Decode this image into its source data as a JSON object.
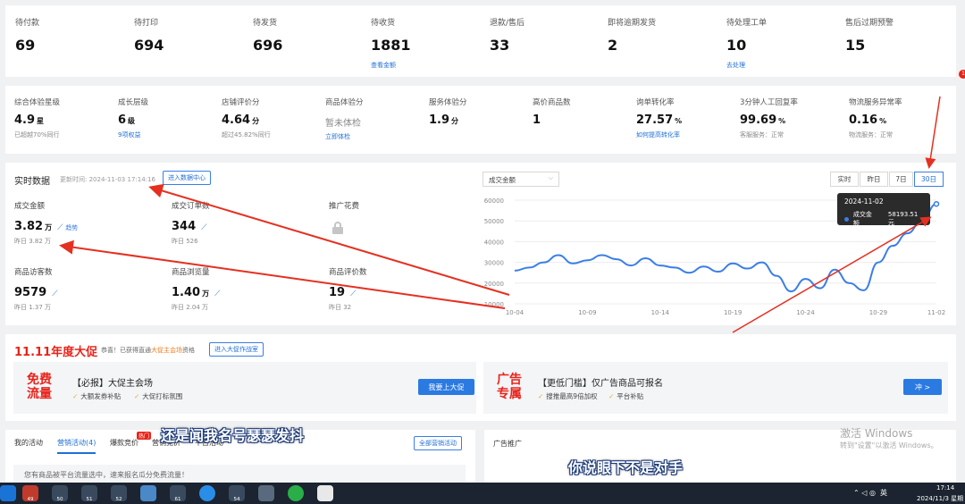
{
  "top_stats": [
    {
      "label": "待付款",
      "value": "69",
      "link": ""
    },
    {
      "label": "待打印",
      "value": "694",
      "link": ""
    },
    {
      "label": "待发货",
      "value": "696",
      "link": ""
    },
    {
      "label": "待收货",
      "value": "1881",
      "link": "查看金额"
    },
    {
      "label": "退款/售后",
      "value": "33",
      "link": ""
    },
    {
      "label": "即将逾期发货",
      "value": "2",
      "link": ""
    },
    {
      "label": "待处理工单",
      "value": "10",
      "link": "去处理"
    },
    {
      "label": "售后过期预警",
      "value": "15",
      "link": ""
    }
  ],
  "metrics": [
    {
      "label": "综合体验星级",
      "value": "4.9",
      "unit": "星",
      "sub": "已超越70%同行",
      "sub_link": false
    },
    {
      "label": "成长层级",
      "value": "6",
      "unit": "级",
      "sub": "9项权益",
      "sub_link": true
    },
    {
      "label": "店铺评价分",
      "value": "4.64",
      "unit": "分",
      "sub": "超过45.82%同行",
      "sub_link": false
    },
    {
      "label": "商品体验分",
      "value": "暂未体检",
      "unit": "",
      "sub": "立即体检",
      "sub_link": true
    },
    {
      "label": "服务体验分",
      "value": "1.9",
      "unit": "分",
      "sub": "",
      "sub_link": false
    },
    {
      "label": "高价商品数",
      "value": "1",
      "unit": "",
      "sub": "",
      "sub_link": false
    },
    {
      "label": "询单转化率",
      "value": "27.57",
      "unit": "%",
      "sub": "如何提高转化率",
      "sub_link": true
    },
    {
      "label": "3分钟人工回复率",
      "value": "99.69",
      "unit": "%",
      "sub": "客服服务：正常",
      "sub_link": false
    },
    {
      "label": "物流服务异常率",
      "value": "0.16",
      "unit": "%",
      "sub": "物流服务：正常",
      "sub_link": false
    }
  ],
  "realtime": {
    "title": "实时数据",
    "updated": "更新时间: 2024-11-03 17:14:16",
    "enter_btn": "进入数据中心",
    "trend_label": "趋势",
    "cells": [
      {
        "label": "成交金额",
        "value": "3.82",
        "unit": "万",
        "sub": "昨日 3.82 万"
      },
      {
        "label": "成交订单数",
        "value": "344",
        "unit": "",
        "sub": "昨日 526"
      },
      {
        "label": "推广花费",
        "value": "",
        "unit": "",
        "sub": ""
      },
      {
        "label": "商品访客数",
        "value": "9579",
        "unit": "",
        "sub": "昨日 1.37 万"
      },
      {
        "label": "商品浏览量",
        "value": "1.40",
        "unit": "万",
        "sub": "昨日 2.04 万"
      },
      {
        "label": "商品评价数",
        "value": "19",
        "unit": "",
        "sub": "昨日 32"
      }
    ]
  },
  "chart_controls": {
    "select_value": "成交金额",
    "ranges": [
      "实时",
      "昨日",
      "7日",
      "30日"
    ],
    "active_range": "30日"
  },
  "tooltip": {
    "date": "2024-11-02",
    "label": "成交金额",
    "value": "58193.51元"
  },
  "chart_data": {
    "type": "line",
    "x": [
      "10-04",
      "10-05",
      "10-06",
      "10-07",
      "10-08",
      "10-09",
      "10-10",
      "10-11",
      "10-12",
      "10-13",
      "10-14",
      "10-15",
      "10-16",
      "10-17",
      "10-18",
      "10-19",
      "10-20",
      "10-21",
      "10-22",
      "10-23",
      "10-24",
      "10-25",
      "10-26",
      "10-27",
      "10-28",
      "10-29",
      "10-30",
      "10-31",
      "11-01",
      "11-02"
    ],
    "x_ticks": [
      "10-04",
      "10-09",
      "10-14",
      "10-19",
      "10-24",
      "10-29",
      "11-02"
    ],
    "series": [
      {
        "values": [
          26000,
          27500,
          30000,
          33500,
          29500,
          31000,
          33500,
          31500,
          28500,
          32000,
          28500,
          27500,
          25000,
          28000,
          25500,
          29500,
          27000,
          30000,
          23500,
          16000,
          22000,
          17500,
          26500,
          20000,
          16500,
          30000,
          38000,
          44000,
          50000,
          58193
        ]
      }
    ],
    "ylim": [
      10000,
      60000
    ],
    "y_ticks": [
      10000,
      20000,
      30000,
      40000,
      50000,
      60000
    ],
    "color": "#3a7ee6",
    "grid": true
  },
  "promo": {
    "title": "11.11年度大促",
    "notice_prefix": "恭喜！已获得直通",
    "notice_highlight": "大促主会场",
    "notice_suffix": "资格",
    "strategy_btn": "进入大促作战室",
    "left": {
      "badge": "免费流量",
      "title": "【必报】大促主会场",
      "perks": [
        "大额发券补贴",
        "大促打标氛围"
      ],
      "btn": "我要上大促"
    },
    "right": {
      "badge": "广告专属",
      "title": "【更低门槛】仅广告商品可报名",
      "perks": [
        "搜推最高9倍加权",
        "平台补贴"
      ],
      "btn": "冲 >"
    }
  },
  "activities": {
    "tabs": [
      "我的活动",
      "营销活动(4)",
      "爆款竞价",
      "营销竞价",
      "平台活动"
    ],
    "hot_badge": "热门",
    "all_btn": "全部营销活动",
    "notice": "您有商品被平台流量选中，速来报名瓜分免费流量！",
    "ad_title": "广告推广"
  },
  "overlay": {
    "sub1": "还是闻我名号瑟瑟发抖",
    "sub2": "你说眼下不是对手"
  },
  "watermark": {
    "line1": "激活 Windows",
    "line2": "转到\"设置\"以激活 Windows。"
  },
  "taskbar": {
    "app_counts": [
      "49",
      "50",
      "51",
      "52",
      "",
      "61",
      "",
      "54"
    ],
    "ime": "英",
    "time": "17:14",
    "date": "2024/11/3 星期"
  },
  "notif_dot": "1"
}
